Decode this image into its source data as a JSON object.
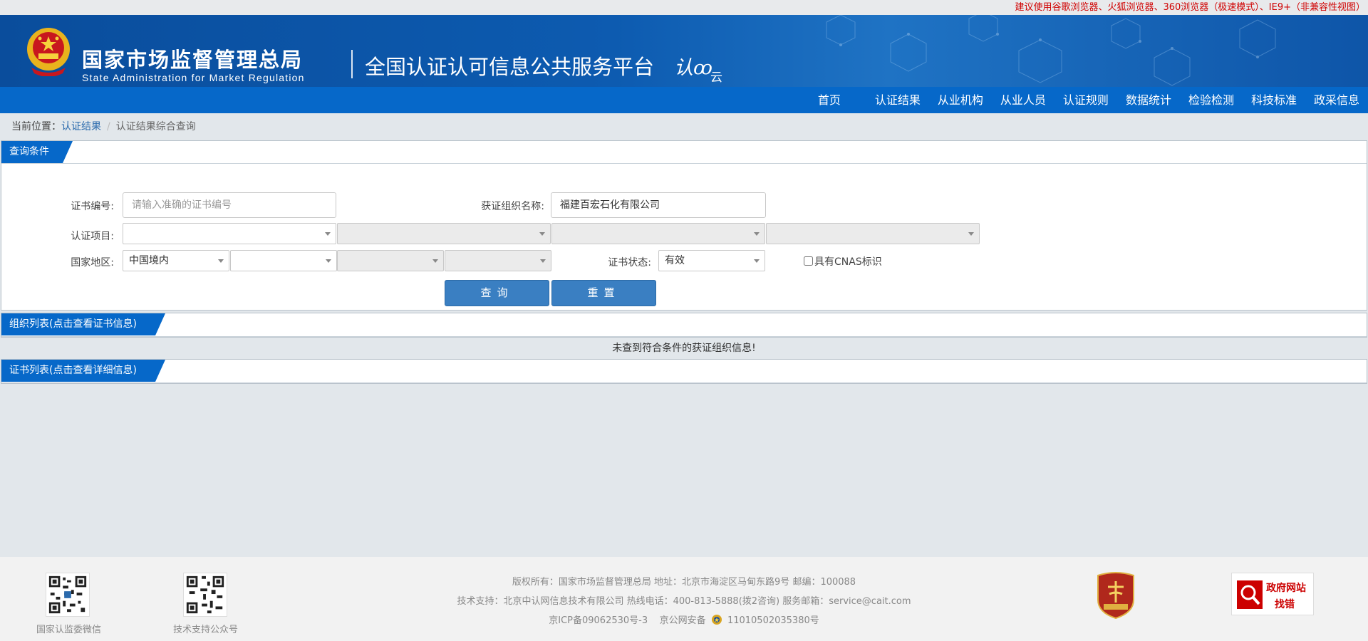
{
  "topbar": {
    "notice": "建议使用谷歌浏览器、火狐浏览器、360浏览器（极速模式）、IE9+（非兼容性视图）"
  },
  "header": {
    "org_cn": "国家市场监督管理总局",
    "org_en": "State Administration  for  Market Regulation",
    "platform": "全国认证认可信息公共服务平台",
    "logo_text": "认",
    "logo_small": "云"
  },
  "nav": {
    "items": [
      "首页",
      "认证结果",
      "从业机构",
      "从业人员",
      "认证规则",
      "数据统计",
      "检验检测",
      "科技标准",
      "政采信息"
    ]
  },
  "breadcrumb": {
    "prefix": "当前位置：",
    "link": "认证结果",
    "separator": "/",
    "current": "认证结果综合查询"
  },
  "query_panel": {
    "title": "查询条件",
    "cert_no_label": "证书编号:",
    "cert_no_placeholder": "请输入准确的证书编号",
    "org_name_label": "获证组织名称:",
    "org_name_value": "福建百宏石化有限公司",
    "project_label": "认证项目:",
    "region_label": "国家地区:",
    "region_value": "中国境内",
    "status_label": "证书状态:",
    "status_value": "有效",
    "cnas_label": "具有CNAS标识",
    "search_button": "查询",
    "reset_button": "重置"
  },
  "org_list": {
    "title": "组织列表(点击查看证书信息)",
    "empty_message": "未查到符合条件的获证组织信息!"
  },
  "cert_list": {
    "title": "证书列表(点击查看详细信息)"
  },
  "footer": {
    "qr1_label": "国家认监委微信",
    "qr2_label": "技术支持公众号",
    "line1": "版权所有：国家市场监督管理总局    地址：北京市海淀区马甸东路9号    邮编：100088",
    "line2": "技术支持：北京中认网信息技术有限公司    热线电话：400-813-5888(拨2咨询)    服务邮箱：service@cait.com",
    "line3_icp": "京ICP备09062530号-3",
    "line3_police": "京公网安备",
    "line3_police_no": "11010502035380号",
    "gov_line1": "政府网站",
    "gov_line2": "找错"
  },
  "colors": {
    "nav_blue": "#0668c9",
    "button_blue": "#3a7fc2",
    "notice_red": "#d00000"
  }
}
